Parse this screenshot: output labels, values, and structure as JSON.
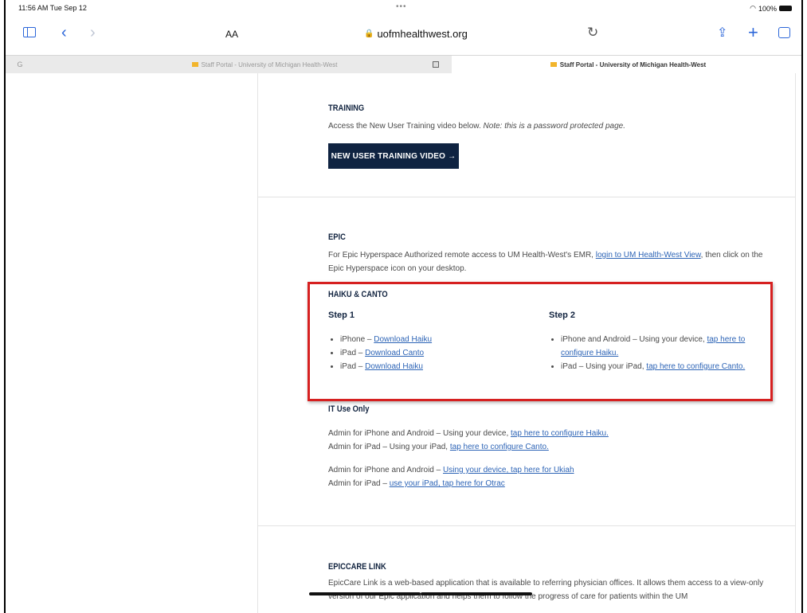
{
  "status": {
    "time": "11:56 AM  Tue Sep 12",
    "dots": "•••",
    "battery": "100%"
  },
  "toolbar": {
    "aa": "AA",
    "url": "uofmhealthwest.org",
    "lock": "🔒"
  },
  "tabs": {
    "google": "G",
    "tab1": "Staff Portal - University of Michigan Health-West",
    "tab3": "Staff Portal - University of Michigan Health-West"
  },
  "training": {
    "heading": "TRAINING",
    "text": "Access the New User Training video below.",
    "note": "Note: this is a password protected page.",
    "button": "NEW USER TRAINING VIDEO →"
  },
  "epic": {
    "heading": "EPIC",
    "text1": "For Epic Hyperspace Authorized remote access to UM Health-West's EMR,",
    "link": "login to UM Health-West View",
    "text2": ", then click on the Epic Hyperspace icon on your desktop."
  },
  "haiku": {
    "heading": "HAIKU & CANTO",
    "step1": "Step 1",
    "step2": "Step 2",
    "s1": [
      {
        "pre": "iPhone – ",
        "link": "Download Haiku"
      },
      {
        "pre": "iPad – ",
        "link": "Download Canto"
      },
      {
        "pre": "iPad – ",
        "link": "Download Haiku"
      }
    ],
    "s2a_pre": "iPhone and Android – Using your device,",
    "s2a_link": "tap here to configure Haiku.",
    "s2b_pre": "iPad – Using your iPad,",
    "s2b_link": "tap here to configure Canto."
  },
  "it": {
    "heading": "IT Use Only",
    "l1_pre": "Admin for iPhone and Android – Using your device,",
    "l1_link": "tap here to configure Haiku.",
    "l2_pre": "Admin for iPad – Using your iPad,",
    "l2_link": "tap here to configure Canto.",
    "l3_pre": "Admin for iPhone and Android –",
    "l3_link": "Using your device, tap here for Ukiah",
    "l4_pre": "Admin for iPad –",
    "l4_link": "use your iPad, tap here for Otrac"
  },
  "epiccare": {
    "heading": "EPICCARE LINK",
    "text": "EpicCare Link is a web-based application that is available to referring physician offices. It allows them access to a view-only version of our Epic application and helps them to follow the progress of care for patients within the UM"
  }
}
